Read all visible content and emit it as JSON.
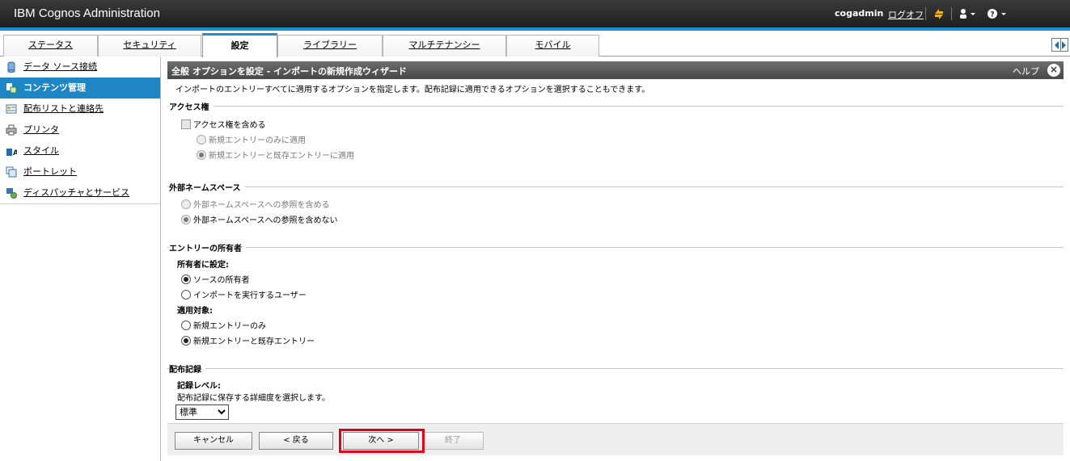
{
  "banner": {
    "app_title": "IBM Cognos Administration",
    "user": "cogadmin",
    "logoff": "ログオフ",
    "icons": [
      "refresh-icon",
      "user-menu-icon",
      "help-menu-icon"
    ]
  },
  "tabs": [
    {
      "label": "ステータス",
      "active": false
    },
    {
      "label": "セキュリティ",
      "active": false
    },
    {
      "label": "設定",
      "active": true
    },
    {
      "label": "ライブラリー",
      "active": false
    },
    {
      "label": "マルチテナンシー",
      "active": false
    },
    {
      "label": "モバイル",
      "active": false
    }
  ],
  "sidebar": {
    "items": [
      {
        "label": "データ ソース接続",
        "icon": "cylinder-icon",
        "active": false
      },
      {
        "label": "コンテンツ管理",
        "icon": "content-icon",
        "active": true
      },
      {
        "label": "配布リストと連絡先",
        "icon": "contacts-icon",
        "active": false
      },
      {
        "label": "プリンタ",
        "icon": "printer-icon",
        "active": false
      },
      {
        "label": "スタイル",
        "icon": "style-icon",
        "active": false
      },
      {
        "label": "ポートレット",
        "icon": "portlet-icon",
        "active": false
      },
      {
        "label": "ディスパッチャとサービス",
        "icon": "dispatcher-icon",
        "active": false
      }
    ]
  },
  "wizard": {
    "title": "全般 オプションを設定 - インポートの新規作成ウィザード",
    "help": "ヘルプ",
    "description": "インポートのエントリーすべてに適用するオプションを指定します。配布記録に適用できるオプションを選択することもできます。",
    "access": {
      "heading": "アクセス権",
      "include_label": "アクセス権を含める",
      "include_checked": false,
      "apply_new_only": "新規エントリーのみに適用",
      "apply_new_existing": "新規エントリーと既存エントリーに適用"
    },
    "external_ns": {
      "heading": "外部ネームスペース",
      "include": "外部ネームスペースへの参照を含める",
      "exclude": "外部ネームスペースへの参照を含めない"
    },
    "owner": {
      "heading": "エントリーの所有者",
      "set_to_label": "所有者に設定:",
      "source_owner": "ソースの所有者",
      "importing_user": "インポートを実行するユーザー",
      "apply_to_label": "適用対象:",
      "new_only": "新規エントリーのみ",
      "new_existing": "新規エントリーと既存エントリー"
    },
    "record": {
      "heading": "配布記録",
      "level_label": "記録レベル:",
      "level_desc": "配布記録に保存する詳細度を選択します。",
      "level_value": "標準"
    },
    "buttons": {
      "cancel": "キャンセル",
      "back": "< 戻る",
      "next": "次へ >",
      "finish": "終了"
    }
  },
  "colors": {
    "accent": "#1b8fd0",
    "active_nav": "#1f86c6",
    "highlight": "#e0001b"
  }
}
